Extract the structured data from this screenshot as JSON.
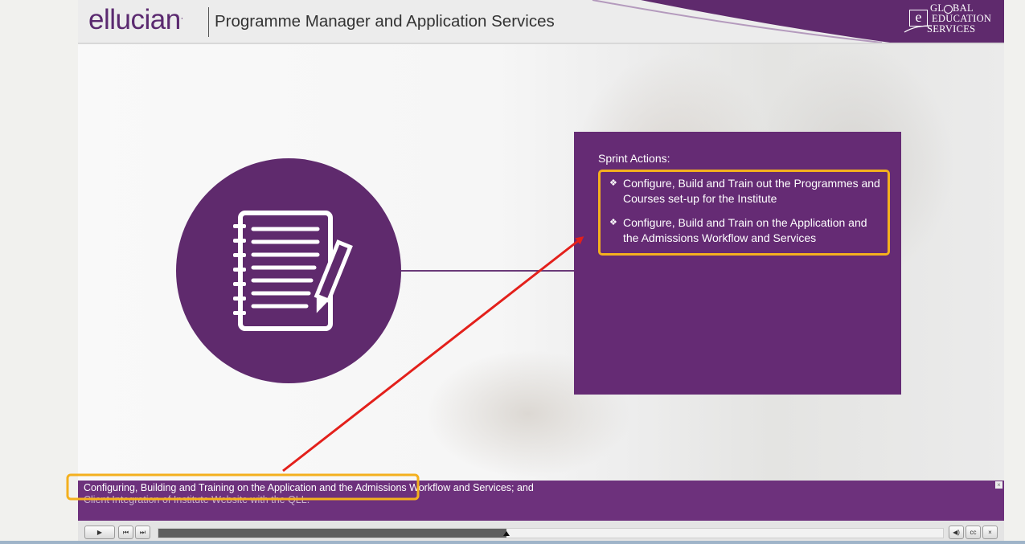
{
  "header": {
    "logo_text": "ellucian",
    "logo_mark": ".",
    "title": "Programme Manager and Application Services",
    "badge": {
      "letter": "e",
      "line1": "GL",
      "line1b": "BAL",
      "line2": "EDUCATION",
      "line3": "SERVICES"
    }
  },
  "panel": {
    "heading": "Sprint Actions:",
    "bullet_glyph": "❖",
    "items": [
      "Configure, Build and Train out the Programmes and Courses set-up for the Institute",
      "Configure, Build and Train on the Application and the Admissions Workflow and Services"
    ]
  },
  "caption": {
    "line1": "Configuring, Building and Training on the Application and the Admissions Workflow and Services; and",
    "line2": "Client Integration of Institute Website with the QLL.",
    "close": "×"
  },
  "controls": {
    "play": "▶",
    "prev": "⏮",
    "next": "⏭",
    "volume": "◀)",
    "cc": "cc",
    "close": "×",
    "progress": 0.444
  },
  "colors": {
    "brand_purple": "#652b74",
    "highlight": "#f4b01e",
    "arrow": "#e3201b"
  },
  "icons": [
    "notebook-icon",
    "pencil-icon",
    "globe-icon"
  ]
}
